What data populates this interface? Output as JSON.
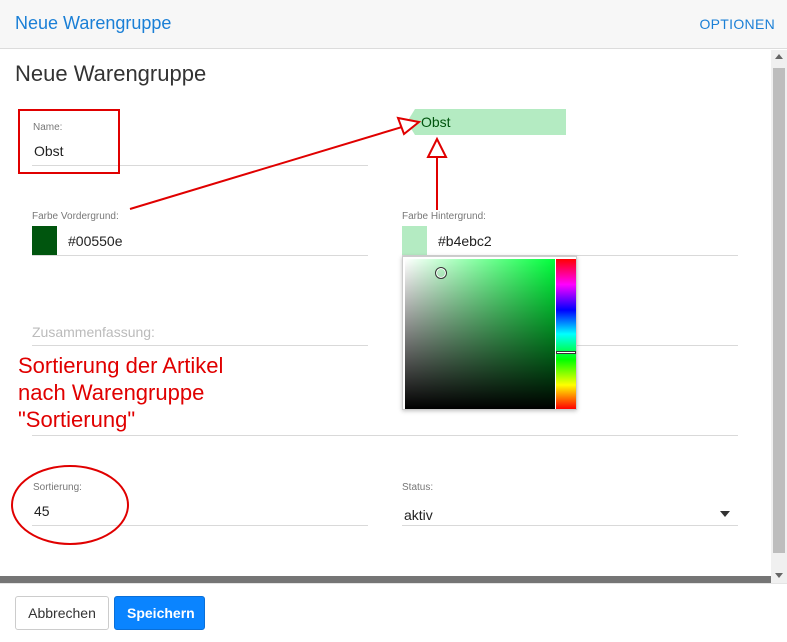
{
  "header": {
    "title": "Neue Warengruppe",
    "options_label": "OPTIONEN"
  },
  "form": {
    "title": "Neue Warengruppe",
    "name": {
      "label": "Name:",
      "value": "Obst"
    },
    "preview_label": "Obst",
    "fg": {
      "label": "Farbe Vordergrund:",
      "value": "#00550e",
      "color": "#00550e"
    },
    "bg": {
      "label": "Farbe Hintergrund:",
      "value": "#b4ebc2",
      "color": "#b4ebc2"
    },
    "summary": {
      "placeholder": "Zusammenfassung:"
    },
    "sort": {
      "label": "Sortierung:",
      "value": "45"
    },
    "status": {
      "label": "Status:",
      "value": "aktiv"
    }
  },
  "picker": {
    "hue_color": "#00ff3c"
  },
  "annotation": {
    "line1": "Sortierung der Artikel",
    "line2": "nach Warengruppe",
    "line3": "\"Sortierung\"",
    "color": "#e00000"
  },
  "footer": {
    "cancel_label": "Abbrechen",
    "save_label": "Speichern"
  }
}
